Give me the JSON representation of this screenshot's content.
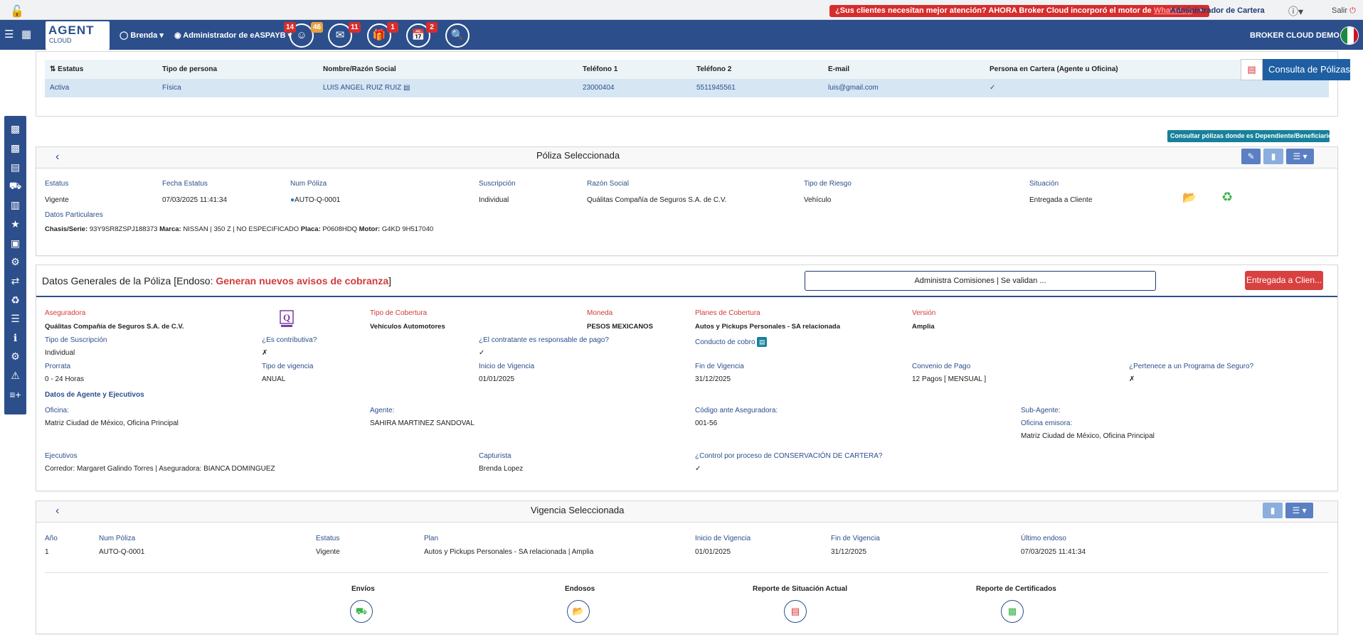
{
  "top": {
    "promo_text": "¿Sus clientes necesitan mejor atención? AHORA Broker Cloud incorporó el motor de",
    "promo_link": "WhatsApp",
    "promo_close": "×",
    "admin_cartera": "Administrador de Cartera",
    "help": "?",
    "salir": "Salir"
  },
  "navbar": {
    "logo_line1": "AGENT",
    "logo_line2": "CLOUD",
    "user": "Brenda",
    "role": "Administrador de eASPAYB",
    "badges": {
      "clients": "14",
      "clients_alt": "46",
      "mail": "11",
      "gift": "1",
      "calendar": "2"
    },
    "brand": "BROKER CLOUD DEMO"
  },
  "clients_table": {
    "headers": [
      "Estatus",
      "Tipo de persona",
      "Nombre/Razón Social",
      "Teléfono 1",
      "Teléfono 2",
      "E-mail",
      "Persona en Cartera (Agente u Oficina)"
    ],
    "row": [
      "Activa",
      "Física",
      "LUIS ANGEL RUIZ RUIZ",
      "23000404",
      "5511945561",
      "luis@gmail.com",
      "✓"
    ],
    "consulta_btn": "Consulta de Pólizas"
  },
  "dependiente_btn": "Consultar pólizas donde es Dependiente/Beneficiario",
  "poliza": {
    "title": "Póliza Seleccionada",
    "fields": [
      {
        "label": "Estatus",
        "value": "Vigente"
      },
      {
        "label": "Fecha Estatus",
        "value": "07/03/2025 11:41:34"
      },
      {
        "label": "Num Póliza",
        "value": "AUTO-Q-0001"
      },
      {
        "label": "Suscripción",
        "value": "Individual"
      },
      {
        "label": "Razón Social",
        "value": "Quálitas Compañía de Seguros S.A. de C.V."
      },
      {
        "label": "Tipo de Riesgo",
        "value": "Vehículo"
      },
      {
        "label": "Situación",
        "value": "Entregada a Cliente"
      }
    ],
    "datos_particulares_label": "Datos Particulares",
    "datos_particulares": {
      "chasis_label": "Chasis/Serie:",
      "chasis": "93Y9SR8ZSPJ188373",
      "marca_label": "Marca:",
      "marca": "NISSAN | 350 Z | NO ESPECIFICADO",
      "placa_label": "Placa:",
      "placa": "P0608HDQ",
      "motor_label": "Motor:",
      "motor": "G4KD 9H517040"
    }
  },
  "datos_generales": {
    "title": "Datos Generales de la Póliza [Endoso:",
    "title_highlight": "Generan nuevos avisos de cobranza",
    "title_end": "]",
    "admin_btn": "Administra Comisiones | Se validan ...",
    "status_btn": "Entregada a Clien...",
    "aseguradora_label": "Aseguradora",
    "aseguradora": "Quálitas Compañía de Seguros S.A. de C.V.",
    "tipo_cobertura_label": "Tipo de Cobertura",
    "tipo_cobertura": "Vehículos Automotores",
    "moneda_label": "Moneda",
    "moneda": "PESOS MEXICANOS",
    "planes_label": "Planes de Cobertura",
    "planes": "Autos y Pickups Personales - SA relacionada",
    "version_label": "Versión",
    "version": "Amplia",
    "tipo_suscripcion_label": "Tipo de Suscripción",
    "tipo_suscripcion": "Individual",
    "contributiva_label": "¿Es contributiva?",
    "contributiva": "✗",
    "contratante_label": "¿El contratante es responsable de pago?",
    "contratante": "✓",
    "conducto_label": "Conducto de cobro",
    "prorrata_label": "Prorrata",
    "prorrata": "0 - 24 Horas",
    "tipo_vigencia_label": "Tipo de vigencia",
    "tipo_vigencia": "ANUAL",
    "inicio_label": "Inicio de Vigencia",
    "inicio": "01/01/2025",
    "fin_label": "Fin de Vigencia",
    "fin": "31/12/2025",
    "convenio_label": "Convenio de Pago",
    "convenio": "12 Pagos [ MENSUAL ]",
    "programa_label": "¿Pertenece a un Programa de Seguro?",
    "programa": "✗",
    "agente_section": "Datos de Agente y Ejecutivos",
    "oficina_label": "Oficina:",
    "oficina": "Matriz Ciudad de México, Oficina Principal",
    "agente_label": "Agente:",
    "agente": "SAHIRA MARTINEZ SANDOVAL",
    "codigo_label": "Código ante Aseguradora:",
    "codigo": "001-56",
    "subagente_label": "Sub-Agente:",
    "emisora_label": "Oficina emisora:",
    "emisora": "Matriz Ciudad de México, Oficina Principal",
    "ejecutivos_label": "Ejecutivos",
    "ejecutivos": "Corredor: Margaret Galindo Torres | Aseguradora: BIANCA DOMINGUEZ",
    "capturista_label": "Capturista",
    "capturista": "Brenda Lopez",
    "control_label": "¿Control por proceso de CONSERVACIÓN DE CARTERA?",
    "control": "✓"
  },
  "vigencia": {
    "title": "Vigencia Seleccionada",
    "fields": [
      {
        "label": "Año",
        "value": "1"
      },
      {
        "label": "Num Póliza",
        "value": "AUTO-Q-0001"
      },
      {
        "label": "Estatus",
        "value": "Vigente"
      },
      {
        "label": "Plan",
        "value": "Autos y Pickups Personales - SA relacionada | Amplia"
      },
      {
        "label": "Inicio de Vigencia",
        "value": "01/01/2025"
      },
      {
        "label": "Fin de Vigencia",
        "value": "31/12/2025"
      },
      {
        "label": "Último endoso",
        "value": "07/03/2025 11:41:34"
      }
    ],
    "actions": [
      "Envíos",
      "Endosos",
      "Reporte de Situación Actual",
      "Reporte de Certificados"
    ]
  },
  "colors": {
    "navy": "#2c4f8c",
    "red": "#d62d2d",
    "teal": "#17819b"
  }
}
